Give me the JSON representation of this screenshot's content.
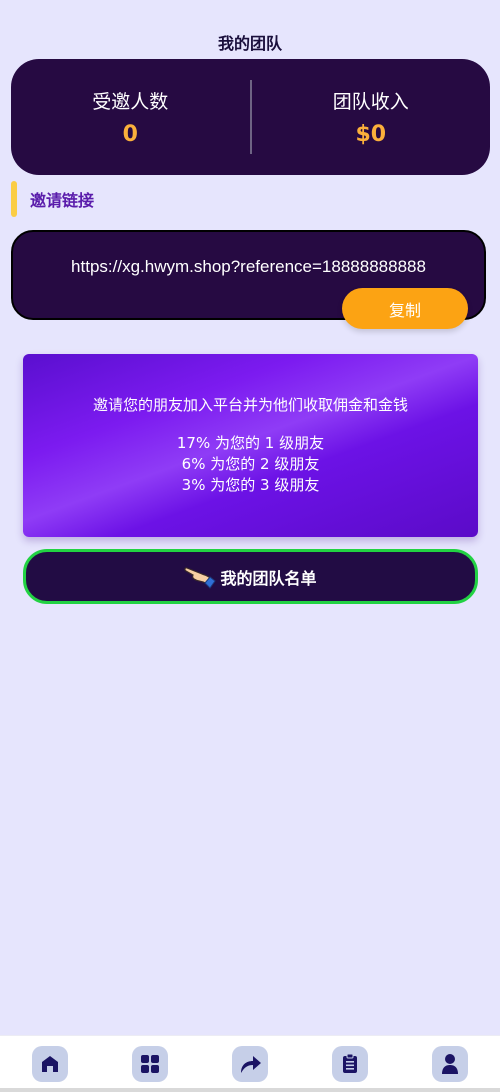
{
  "header": {
    "title": "我的团队"
  },
  "stats": {
    "invited_label": "受邀人数",
    "invited_value": "0",
    "income_label": "团队收入",
    "income_value": "$0"
  },
  "invite": {
    "section_title": "邀请链接",
    "link": "https://xg.hwym.shop?reference=18888888888",
    "copy_label": "复制"
  },
  "promo": {
    "title": "邀请您的朋友加入平台并为他们收取佣金和金钱",
    "lines": [
      "17% 为您的 1 级朋友",
      "6% 为您的 2 级朋友",
      "3% 为您的 3 级朋友"
    ]
  },
  "team_button": {
    "label": "我的团队名单",
    "icon": "pointing-hand-icon"
  },
  "tabbar": {
    "items": [
      {
        "icon": "home-icon"
      },
      {
        "icon": "grid-icon"
      },
      {
        "icon": "share-arrow-icon"
      },
      {
        "icon": "clipboard-icon"
      },
      {
        "icon": "user-icon"
      }
    ]
  },
  "colors": {
    "background": "#e6e5fd",
    "card": "#260a42",
    "accent_gold": "#fbb03b",
    "copy_button": "#fca313",
    "team_border": "#22d243",
    "section_title": "#5a1cab"
  }
}
